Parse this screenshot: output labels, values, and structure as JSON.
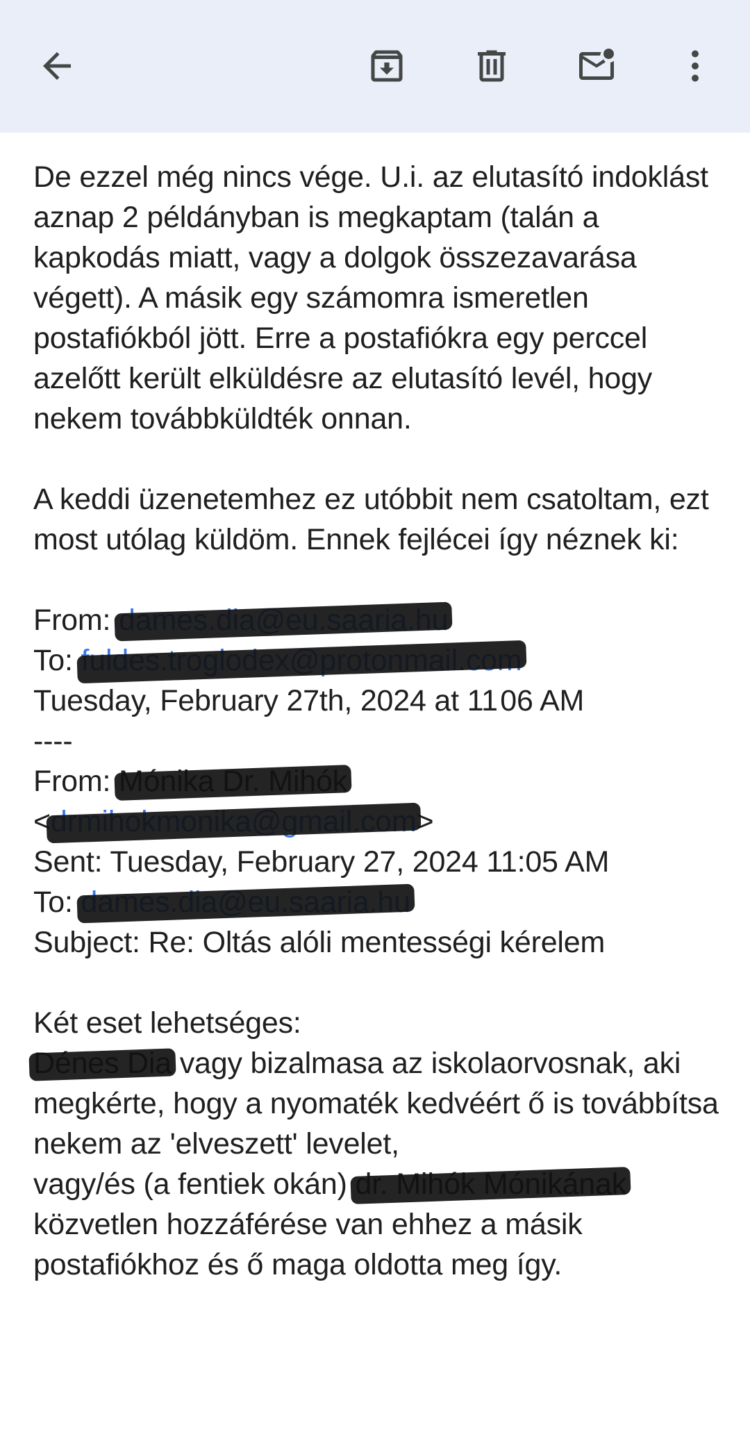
{
  "toolbar": {
    "back_icon": "arrow-back-icon",
    "archive_icon": "archive-icon",
    "delete_icon": "trash-icon",
    "mark_unread_icon": "mark-unread-icon",
    "more_icon": "more-vertical-icon"
  },
  "body": {
    "p1": "De ezzel még nincs vége. U.i. az elutasító indoklást aznap 2 példányban is megkaptam (talán a kapkodás miatt, vagy a dolgok összezavarása végett). A másik egy számomra ismeretlen postafiókból jött. Erre a postafiókra egy perccel azelőtt került elküldésre az elutasító levél, hogy nekem továbbküldték onnan.",
    "p2": "A keddi üzenetemhez ez utóbbit nem csatoltam, ezt most utólag küldöm. Ennek fejlécei így néznek ki:",
    "h1_from_label": "From: ",
    "h1_from_value": "dames.dia@eu.saaria.hu",
    "h1_to_label": "To: ",
    "h1_to_value": "fuldes.troglodex@protonmail.com",
    "h1_date": "Tuesday, February 27th, 2024 at 11 06 AM",
    "separator": "----",
    "h2_from_label": "From: ",
    "h2_from_name": "Mónika Dr. Mihók",
    "h2_email_open": "<",
    "h2_email": "drmihokmonika@gmail.com",
    "h2_email_close": ">",
    "h2_sent": "Sent: Tuesday, February 27, 2024 11:05 AM",
    "h2_to_label": "To: ",
    "h2_to_value": "dames.dia@eu.saaria.hu",
    "h2_subject": "Subject: Re: Oltás alóli mentességi kérelem",
    "p3_line1": "Két eset lehetséges:",
    "p3_name": "Dénes Dia",
    "p3_rest": " vagy bizalmasa az iskolaorvosnak, aki megkérte, hogy a nyomaték kedvéért ő is továbbítsa nekem az 'elveszett' levelet,",
    "p4_start": "vagy/és (a fentiek okán) ",
    "p4_name": "dr. Mihók Mónikának",
    "p4_rest": " közvetlen hozzáférése van ehhez a másik postafiókhoz és ő maga oldotta meg így."
  }
}
